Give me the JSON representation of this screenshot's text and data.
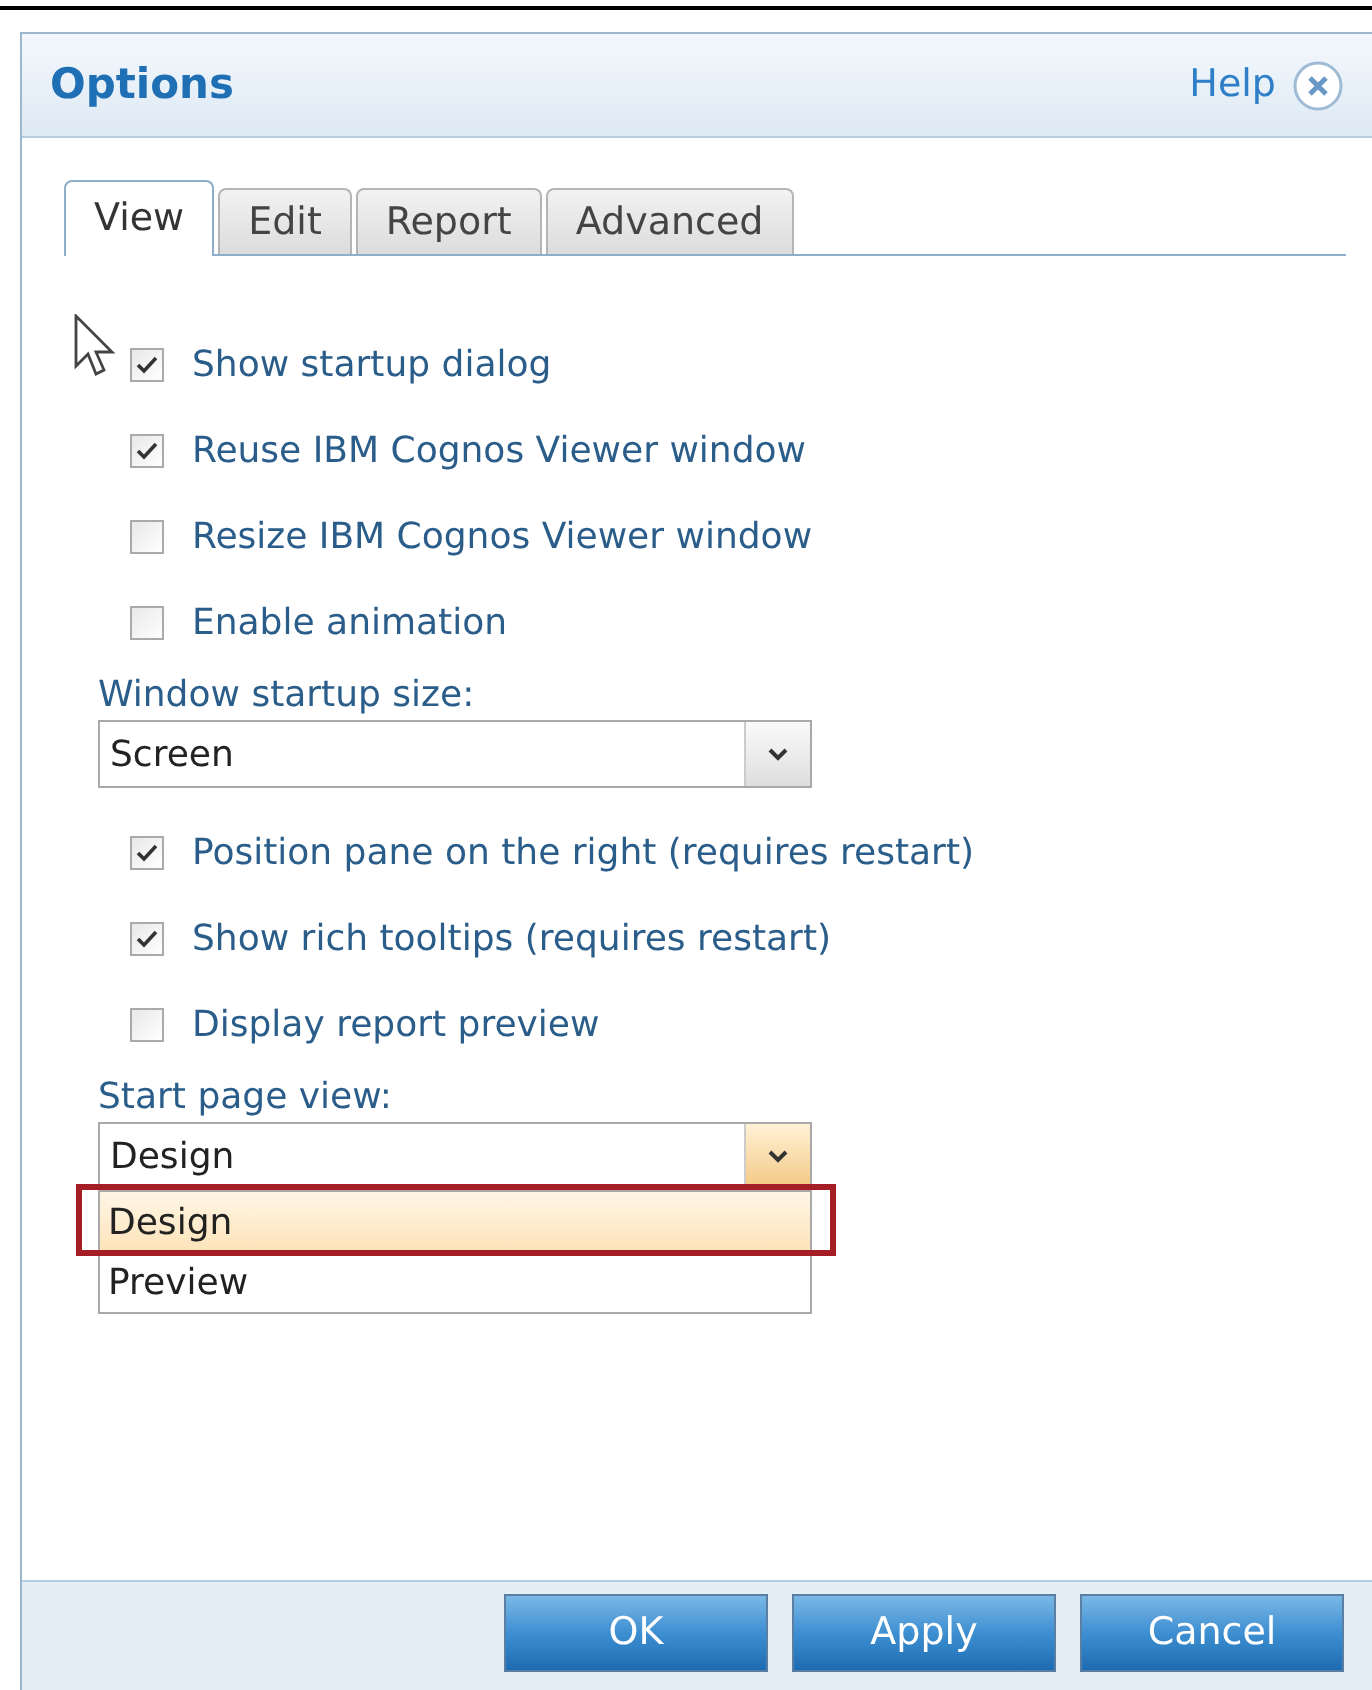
{
  "window": {
    "title": "Options",
    "help": "Help"
  },
  "tabs": [
    {
      "label": "View",
      "selected": true
    },
    {
      "label": "Edit",
      "selected": false
    },
    {
      "label": "Report",
      "selected": false
    },
    {
      "label": "Advanced",
      "selected": false
    }
  ],
  "items": [
    {
      "kind": "checkbox",
      "label": "Show startup dialog",
      "checked": true
    },
    {
      "kind": "checkbox",
      "label": "Reuse IBM Cognos Viewer window",
      "checked": true
    },
    {
      "kind": "checkbox",
      "label": "Resize IBM Cognos Viewer window",
      "checked": false
    },
    {
      "kind": "checkbox",
      "label": "Enable animation",
      "checked": false
    },
    {
      "kind": "select",
      "label": "Window startup size:",
      "value": "Screen",
      "expanded": false
    },
    {
      "kind": "checkbox",
      "label": "Position pane on the right (requires restart)",
      "checked": true
    },
    {
      "kind": "checkbox",
      "label": "Show rich tooltips (requires restart)",
      "checked": true
    },
    {
      "kind": "checkbox",
      "label": "Display report preview",
      "checked": false
    },
    {
      "kind": "select",
      "label": "Start page view:",
      "value": "Design",
      "expanded": true,
      "options": [
        {
          "label": "Design",
          "selected": true,
          "outlined": true
        },
        {
          "label": "Preview",
          "selected": false,
          "outlined": false
        }
      ]
    }
  ],
  "buttons": [
    "OK",
    "Apply",
    "Cancel"
  ]
}
